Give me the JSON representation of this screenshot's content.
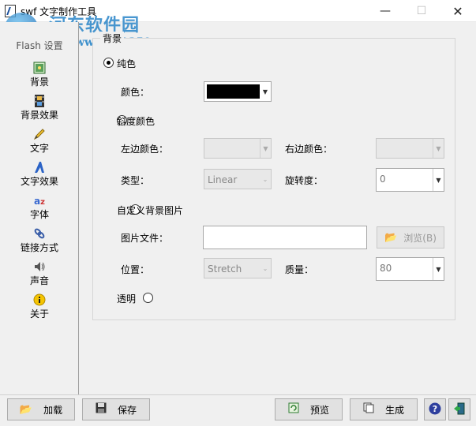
{
  "window": {
    "title": "swf 文字制作工具"
  },
  "watermark": {
    "text": "河东软件园",
    "url": "www.pc0359.cn"
  },
  "sidebar": {
    "items": [
      {
        "label": "Flash 设置",
        "icon": "flash-icon"
      },
      {
        "label": "背景",
        "icon": "background-icon"
      },
      {
        "label": "背景效果",
        "icon": "film-icon"
      },
      {
        "label": "文字",
        "icon": "pencil-icon"
      },
      {
        "label": "文字效果",
        "icon": "text-effect-icon"
      },
      {
        "label": "字体",
        "icon": "font-icon"
      },
      {
        "label": "链接方式",
        "icon": "link-icon"
      },
      {
        "label": "声音",
        "icon": "speaker-icon"
      },
      {
        "label": "关于",
        "icon": "info-icon"
      }
    ]
  },
  "background_panel": {
    "title": "背景",
    "solid": {
      "label": "纯色",
      "color_label": "颜色：",
      "color_value": "#000000",
      "selected": true
    },
    "gradient": {
      "label": "斜度颜色",
      "left_color_label": "左边颜色：",
      "right_color_label": "右边颜色：",
      "type_label": "类型：",
      "type_value": "Linear",
      "rotation_label": "旋转度：",
      "rotation_value": "0"
    },
    "custom_image": {
      "label": "自定义背景图片",
      "file_label": "图片文件：",
      "file_value": "",
      "browse_label": "浏览(B)",
      "position_label": "位置：",
      "position_value": "Stretch",
      "quality_label": "质量：",
      "quality_value": "80"
    },
    "transparent": {
      "label": "透明"
    }
  },
  "bottom": {
    "load_label": "加载",
    "save_label": "保存",
    "preview_label": "预览",
    "generate_label": "生成"
  }
}
